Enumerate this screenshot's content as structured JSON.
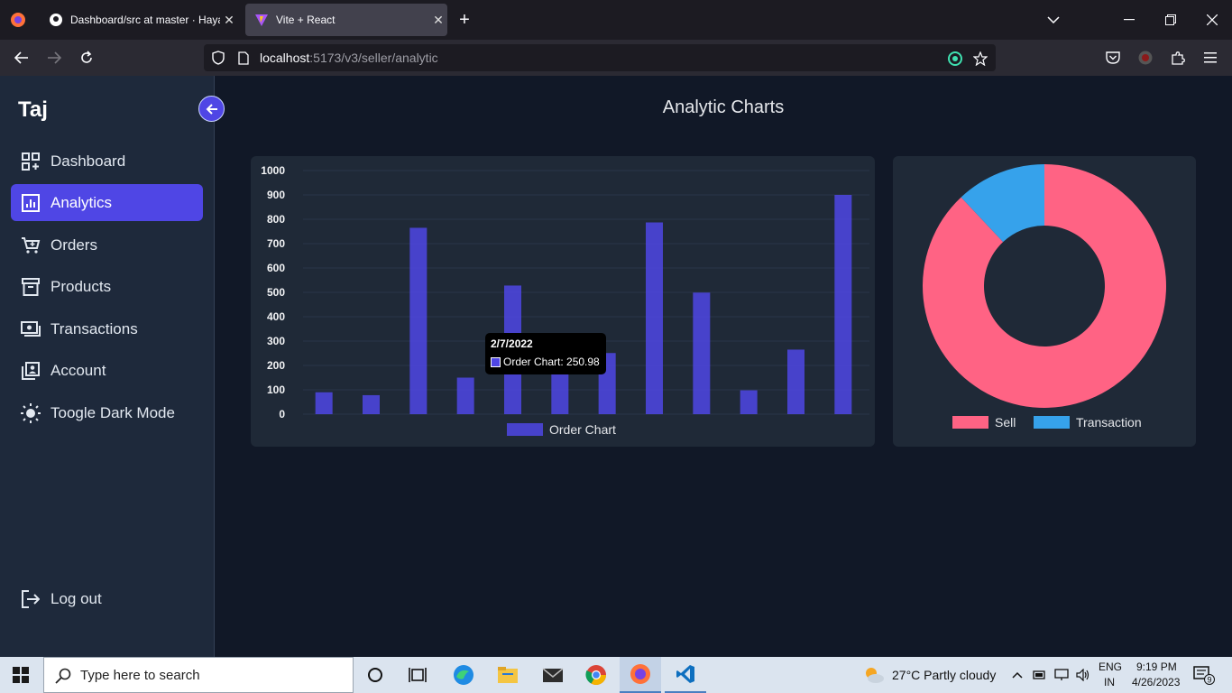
{
  "browser": {
    "tabs": [
      {
        "title": "Dashboard/src at master · Hayat",
        "active": false
      },
      {
        "title": "Vite + React",
        "active": true
      }
    ],
    "url_host": "localhost",
    "url_path": ":5173/v3/seller/analytic"
  },
  "sidebar": {
    "brand": "Taj",
    "items": [
      {
        "label": "Dashboard",
        "icon": "dashboard-icon",
        "active": false
      },
      {
        "label": "Analytics",
        "icon": "analytics-icon",
        "active": true
      },
      {
        "label": "Orders",
        "icon": "cart-icon",
        "active": false
      },
      {
        "label": "Products",
        "icon": "archive-icon",
        "active": false
      },
      {
        "label": "Transactions",
        "icon": "money-icon",
        "active": false
      },
      {
        "label": "Account",
        "icon": "account-icon",
        "active": false
      },
      {
        "label": "Toogle Dark Mode",
        "icon": "sun-icon",
        "active": false
      }
    ],
    "logout": "Log out"
  },
  "main": {
    "title": "Analytic Charts"
  },
  "tooltip": {
    "date": "2/7/2022",
    "text": "Order Chart: 250.98"
  },
  "chart_data": [
    {
      "type": "bar",
      "series": [
        {
          "name": "Order Chart",
          "values": [
            90,
            78,
            765,
            150,
            528,
            298,
            251,
            787,
            499,
            98,
            265,
            900
          ]
        }
      ],
      "ylim": [
        0,
        1000
      ],
      "yticks": [
        0,
        100,
        200,
        300,
        400,
        500,
        600,
        700,
        800,
        900,
        1000
      ],
      "legend": "bottom",
      "color": "#4f46e5",
      "grid": true
    },
    {
      "type": "pie",
      "labels": [
        "Sell",
        "Transaction"
      ],
      "values": [
        88,
        12
      ],
      "colors": [
        "#ff6384",
        "#36a2eb"
      ],
      "legend": "bottom"
    }
  ],
  "taskbar": {
    "search_placeholder": "Type here to search",
    "weather": "27°C  Partly cloudy",
    "lang1": "ENG",
    "lang2": "IN",
    "time": "9:19 PM",
    "date": "4/26/2023",
    "notif_count": "9"
  }
}
